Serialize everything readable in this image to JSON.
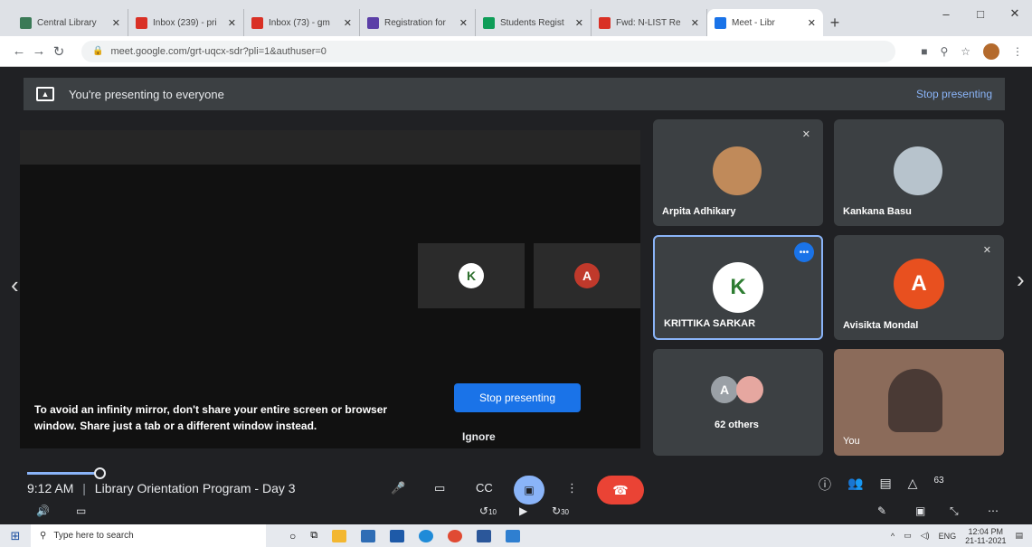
{
  "browser": {
    "tabs": [
      {
        "title": "Central Library",
        "favicon_color": "#3b7a57"
      },
      {
        "title": "Inbox (239) - pri",
        "favicon_color": "#d93025"
      },
      {
        "title": "Inbox (73) - gm",
        "favicon_color": "#d93025"
      },
      {
        "title": "Registration for",
        "favicon_color": "#5b3fa7"
      },
      {
        "title": "Students Regist",
        "favicon_color": "#0f9d58"
      },
      {
        "title": "Fwd: N-LIST Re",
        "favicon_color": "#d93025"
      },
      {
        "title": "Meet - Libr",
        "favicon_color": "#1a73e8",
        "active": true
      }
    ],
    "new_tab": "+",
    "url": "meet.google.com/grt-uqcx-sdr?pli=1&authuser=0"
  },
  "meet": {
    "banner_text": "You're presenting to everyone",
    "banner_stop": "Stop presenting",
    "warning_text": "To avoid an infinity mirror, don't share your entire screen or browser window. Share just a tab or a different window instead.",
    "stop_button": "Stop presenting",
    "ignore_button": "Ignore",
    "participants": [
      {
        "name": "Arpita Adhikary",
        "muted": true
      },
      {
        "name": "Kankana Basu",
        "muted": false
      },
      {
        "name": "KRITTIKA SARKAR",
        "initial": "K",
        "selected": true
      },
      {
        "name": "Avisikta Mondal",
        "initial": "A",
        "muted": true,
        "color": "#e8501f"
      },
      {
        "name": "62 others",
        "initial": "A"
      },
      {
        "name": "You"
      }
    ],
    "meeting_time": "9:12 AM",
    "meeting_title": "Library Orientation Program - Day 3",
    "participant_count": "63",
    "seek_back": "10",
    "seek_forward": "30"
  },
  "taskbar": {
    "search_placeholder": "Type here to search",
    "lang": "ENG",
    "time": "12:04 PM",
    "date": "21-11-2021"
  }
}
